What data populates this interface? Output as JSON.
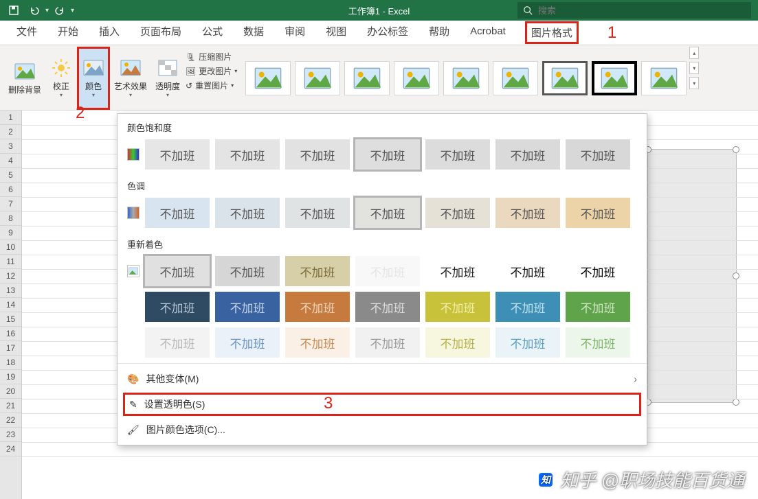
{
  "title": "工作簿1 - Excel",
  "search_placeholder": "搜索",
  "qat": {
    "save": "save-icon",
    "undo": "undo-icon",
    "redo": "redo-icon"
  },
  "tabs": [
    "文件",
    "开始",
    "插入",
    "页面布局",
    "公式",
    "数据",
    "审阅",
    "视图",
    "办公标签",
    "帮助",
    "Acrobat",
    "图片格式"
  ],
  "active_tab_index": 11,
  "annotations": {
    "one": "1",
    "two": "2",
    "three": "3"
  },
  "ribbon": {
    "remove_bg": "删除背景",
    "corrections": "校正",
    "color": "颜色",
    "artistic": "艺术效果",
    "transparency": "透明度",
    "compress": "压缩图片",
    "change": "更改图片",
    "reset": "重置图片"
  },
  "dropdown": {
    "section_saturation": "颜色饱和度",
    "section_tone": "色调",
    "section_recolor": "重新着色",
    "sample_text": "不加班",
    "more_variants": "其他变体(M)",
    "set_transparent": "设置透明色(S)",
    "color_options": "图片颜色选项(C)..."
  },
  "row_count": 24,
  "watermark": "知乎 @职场技能百货通"
}
